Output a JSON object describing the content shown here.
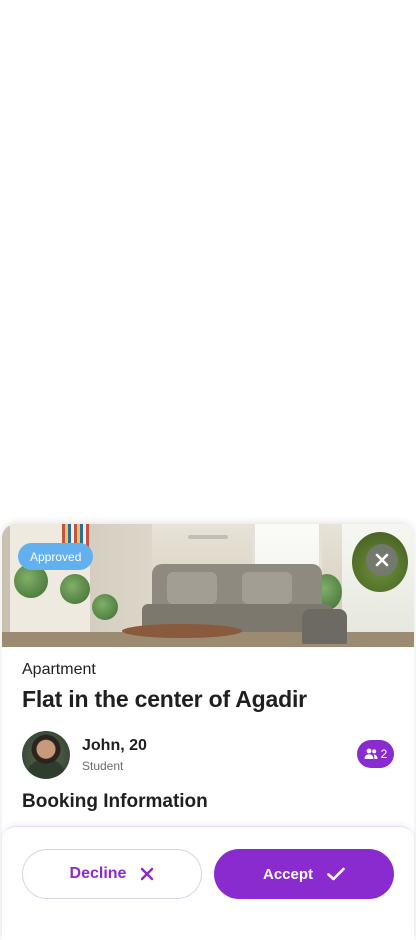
{
  "listing": {
    "status_badge": "Approved",
    "type": "Apartment",
    "title": "Flat in the center of Agadir",
    "photo_icon": "apartment-living-room-photo"
  },
  "host": {
    "name": "John, 20",
    "role": "Student",
    "avatar_icon": "user-avatar"
  },
  "guests": {
    "count": "2",
    "icon": "people-icon"
  },
  "sections": {
    "booking_info": "Booking Information"
  },
  "actions": {
    "decline_label": "Decline",
    "accept_label": "Accept"
  },
  "colors": {
    "accent": "#8a2bd0",
    "approved_badge": "#63b0ef"
  }
}
